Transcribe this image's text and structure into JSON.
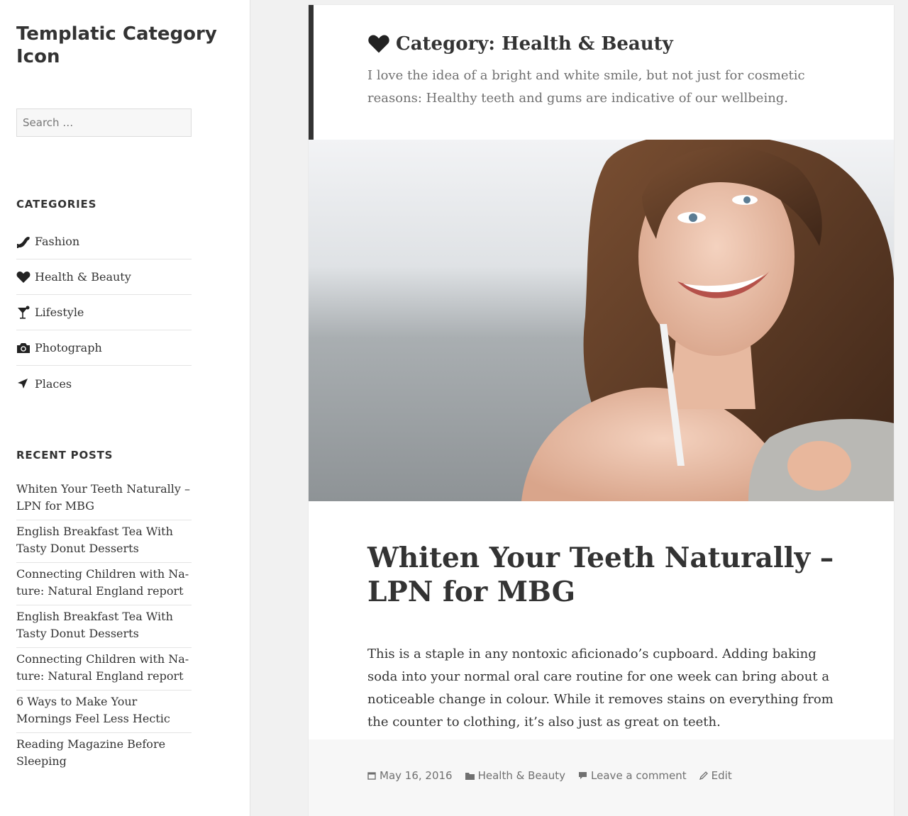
{
  "site": {
    "title": "Templatic Category Icon"
  },
  "search": {
    "placeholder": "Search …"
  },
  "categories": {
    "heading": "CATEGORIES",
    "items": [
      {
        "label": "Fashion",
        "icon": "heel-icon"
      },
      {
        "label": "Health & Beauty",
        "icon": "heart-icon"
      },
      {
        "label": "Lifestyle",
        "icon": "cocktail-icon"
      },
      {
        "label": "Photograph",
        "icon": "camera-icon"
      },
      {
        "label": "Places",
        "icon": "location-arrow-icon"
      }
    ]
  },
  "recent_posts": {
    "heading": "RECENT POSTS",
    "items": [
      "Whiten Your Teeth Naturally – LPN for MBG",
      "English Breakfast Tea With Tasty Donut Desserts",
      "Connecting Children with Na- ture: Natural England report",
      "English Breakfast Tea With Tasty Donut Desserts",
      "Connecting Children with Na- ture: Natural England report",
      "6 Ways to Make Your Mornings Feel Less Hectic",
      "Reading Magazine Before Sleeping"
    ]
  },
  "archive": {
    "title": "Category: Health & Beauty",
    "description": "I love the idea of a bright and white smile, but not just for cosmetic reasons: Healthy teeth and gums are indicative of our wellbeing."
  },
  "post": {
    "title": "Whiten Your Teeth Naturally – LPN for MBG",
    "excerpt": "This is a staple in any nontoxic aficionado’s cupboard. Adding baking soda into your normal oral care routine for one week can bring about a noticeable change in colour. While it removes stains on everything from the counter to clothing, it’s also just as great on teeth.",
    "meta": {
      "date": "May 16, 2016",
      "category": "Health & Beauty",
      "comment": "Leave a comment",
      "edit": "Edit"
    }
  },
  "colors": {
    "accent": "#333333",
    "muted": "#707070",
    "background": "#f1f1f1"
  }
}
